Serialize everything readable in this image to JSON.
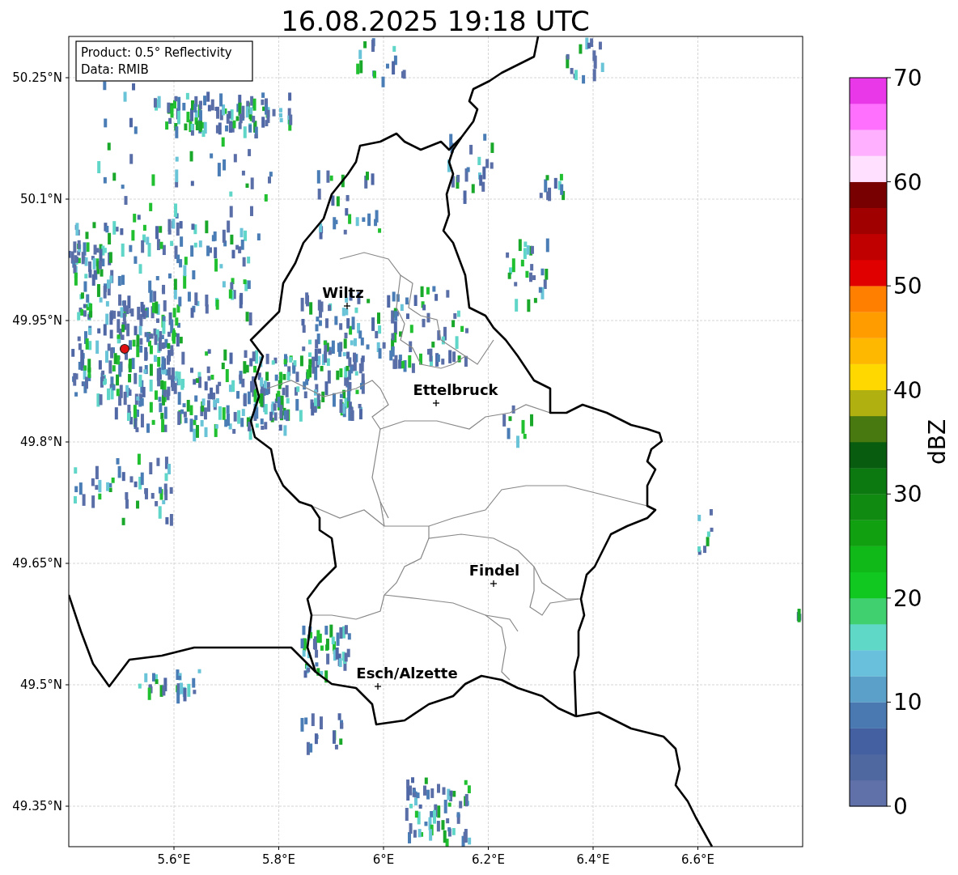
{
  "title": "16.08.2025 19:18 UTC",
  "info_box": [
    "Product: 0.5° Reflectivity",
    "Data: RMIB"
  ],
  "cities": [
    {
      "name": "Wiltz"
    },
    {
      "name": "Ettelbruck"
    },
    {
      "name": "Findel"
    },
    {
      "name": "Esch/Alzette"
    }
  ],
  "x_ticks": [
    "5.6°E",
    "5.8°E",
    "6°E",
    "6.2°E",
    "6.4°E",
    "6.6°E"
  ],
  "y_ticks": [
    "50.25°N",
    "50.1°N",
    "49.95°N",
    "49.8°N",
    "49.65°N",
    "49.5°N",
    "49.35°N"
  ],
  "colorbar": {
    "label": "dBZ",
    "ticks": [
      "70",
      "60",
      "50",
      "40",
      "30",
      "20",
      "10",
      "0"
    ],
    "bins": [
      {
        "color": "#6070a8"
      },
      {
        "color": "#5068a0"
      },
      {
        "color": "#4460a0"
      },
      {
        "color": "#4a78b0"
      },
      {
        "color": "#5aa0c8"
      },
      {
        "color": "#68c0dc"
      },
      {
        "color": "#60d8c8"
      },
      {
        "color": "#40d070"
      },
      {
        "color": "#10c820"
      },
      {
        "color": "#10b818"
      },
      {
        "color": "#10a010"
      },
      {
        "color": "#108a10"
      },
      {
        "color": "#0c7810"
      },
      {
        "color": "#085c10"
      },
      {
        "color": "#487810"
      },
      {
        "color": "#b0b010"
      },
      {
        "color": "#ffd800"
      },
      {
        "color": "#ffb800"
      },
      {
        "color": "#ff9c00"
      },
      {
        "color": "#ff8000"
      },
      {
        "color": "#e00000"
      },
      {
        "color": "#c00000"
      },
      {
        "color": "#a00000"
      },
      {
        "color": "#780000"
      },
      {
        "color": "#ffe0ff"
      },
      {
        "color": "#ffb0ff"
      },
      {
        "color": "#ff70ff"
      },
      {
        "color": "#e838e8"
      }
    ]
  }
}
